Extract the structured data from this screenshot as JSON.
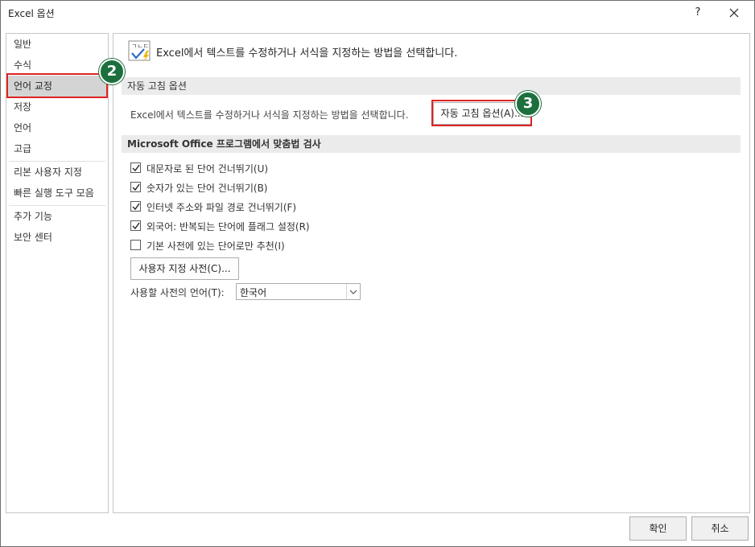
{
  "window": {
    "title": "Excel 옵션",
    "help_label": "?",
    "close_label": "✕"
  },
  "sidebar": {
    "items": [
      {
        "label": "일반"
      },
      {
        "label": "수식"
      },
      {
        "label": "언어 교정",
        "selected": true
      },
      {
        "label": "저장"
      },
      {
        "label": "언어"
      },
      {
        "label": "고급"
      },
      {
        "label": "리본 사용자 지정"
      },
      {
        "label": "빠른 실행 도구 모음"
      },
      {
        "label": "추가 기능"
      },
      {
        "label": "보안 센터"
      }
    ]
  },
  "main": {
    "header_icon": "proofing-abc-check-icon",
    "header_text": "Excel에서 텍스트를 수정하거나 서식을 지정하는 방법을 선택합니다.",
    "autocorrect_section": {
      "title": "자동 고침 옵션",
      "description": "Excel에서 텍스트를 수정하거나 서식을 지정하는 방법을 선택합니다.",
      "button_label": "자동 고침 옵션(A)..."
    },
    "spelling_section": {
      "title": "Microsoft Office 프로그램에서 맞춤법 검사",
      "checkboxes": [
        {
          "label": "대문자로 된 단어 건너뛰기(U)",
          "checked": true
        },
        {
          "label": "숫자가 있는 단어 건너뛰기(B)",
          "checked": true
        },
        {
          "label": "인터넷 주소와 파일 경로 건너뛰기(F)",
          "checked": true
        },
        {
          "label": "외국어: 반복되는 단어에 플래그 설정(R)",
          "checked": true
        },
        {
          "label": "기본 사전에 있는 단어로만 추천(I)",
          "checked": false
        }
      ],
      "custom_dict_button": "사용자 지정 사전(C)...",
      "dictionary_language_label": "사용할 사전의 언어(T):",
      "dictionary_language_value": "한국어"
    }
  },
  "footer": {
    "ok_label": "확인",
    "cancel_label": "취소"
  },
  "annotations": {
    "marker_2": "2",
    "marker_3": "3",
    "highlight_color": "#e02222",
    "marker_color": "#1d6f3e"
  }
}
